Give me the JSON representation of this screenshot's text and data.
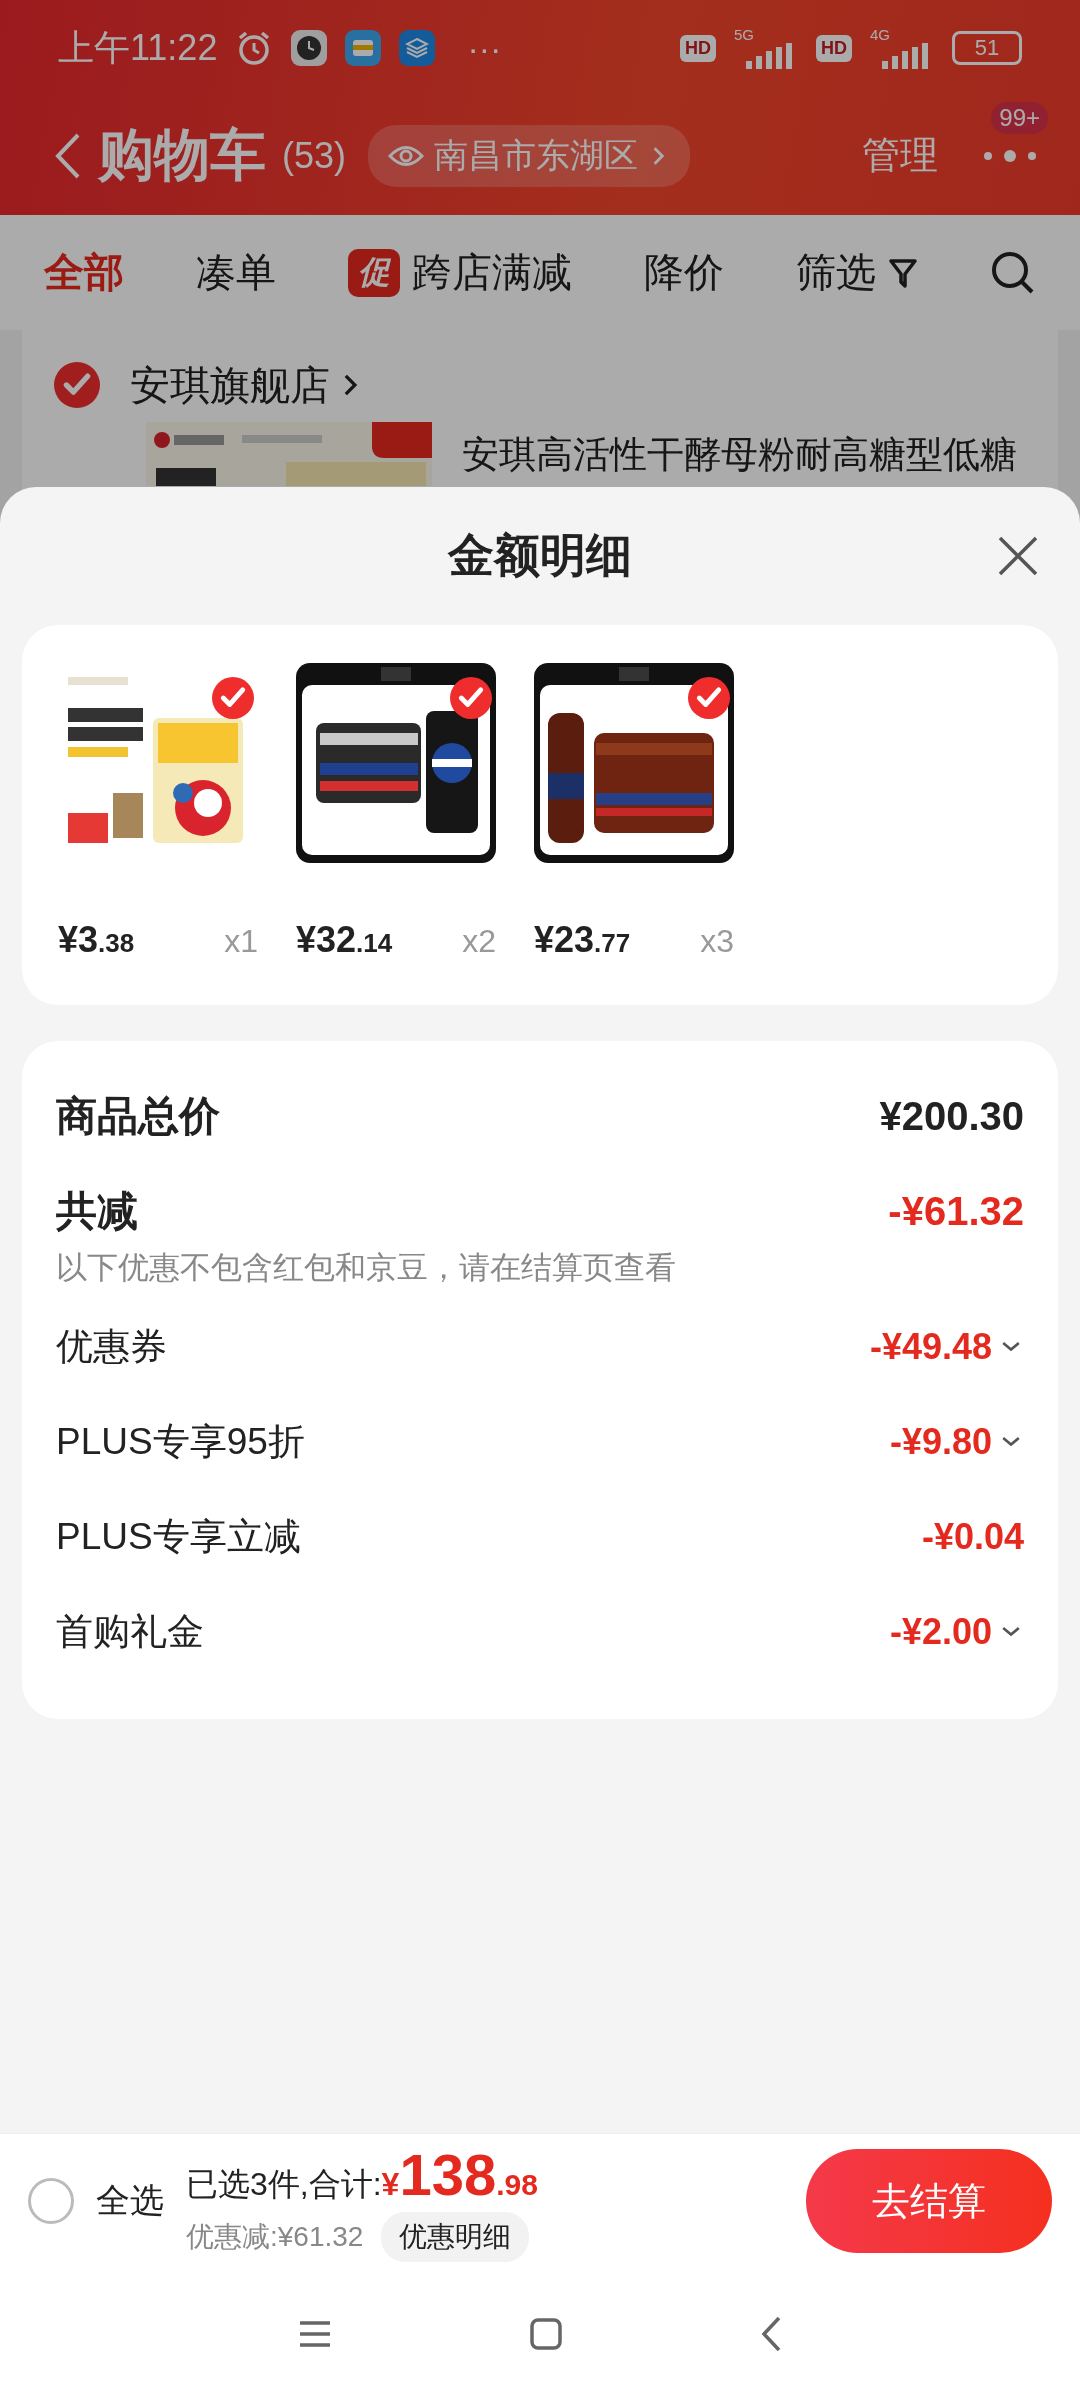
{
  "status_bar": {
    "time": "上午11:22",
    "more": "···",
    "sim1": {
      "hd": "HD",
      "network": "5G"
    },
    "sim2": {
      "hd": "HD",
      "network": "4G"
    },
    "battery": "51"
  },
  "header": {
    "title": "购物车",
    "count": "(53)",
    "location": "南昌市东湖区",
    "manage": "管理",
    "badge": "99+"
  },
  "filter_tabs": [
    {
      "label": "全部",
      "selected": true,
      "kind": "text"
    },
    {
      "label": "凑单",
      "selected": false,
      "kind": "text"
    },
    {
      "label": "跨店满减",
      "selected": false,
      "kind": "promo",
      "tag": "促"
    },
    {
      "label": "降价",
      "selected": false,
      "kind": "text"
    },
    {
      "label": "筛选",
      "selected": false,
      "kind": "filter"
    }
  ],
  "store": {
    "name": "安琪旗舰店",
    "checked": true,
    "product_title": "安琪高活性干酵母粉耐高糖型低糖"
  },
  "sheet": {
    "title": "金额明细",
    "items": [
      {
        "price_main": "¥3",
        "price_decimal": ".38",
        "quantity": "x1",
        "checked": true
      },
      {
        "price_main": "¥32",
        "price_decimal": ".14",
        "quantity": "x2",
        "checked": true
      },
      {
        "price_main": "¥23",
        "price_decimal": ".77",
        "quantity": "x3",
        "checked": true
      }
    ],
    "total": {
      "label": "商品总价",
      "amount": "¥200.30"
    },
    "reduction": {
      "label": "共减",
      "amount": "-¥61.32",
      "note": "以下优惠不包含红包和京豆，请在结算页查看"
    },
    "discounts": [
      {
        "label": "优惠券",
        "amount": "-¥49.48",
        "expandable": true
      },
      {
        "label": "PLUS专享95折",
        "amount": "-¥9.80",
        "expandable": true
      },
      {
        "label": "PLUS专享立减",
        "amount": "-¥0.04",
        "expandable": false
      },
      {
        "label": "首购礼金",
        "amount": "-¥2.00",
        "expandable": true
      }
    ]
  },
  "bottom_bar": {
    "select_all": {
      "label": "全选",
      "checked": false
    },
    "summary": "已选3件,合计:",
    "currency": "¥",
    "total_main": "138",
    "total_decimal": ".98",
    "saving": "优惠减:¥61.32",
    "detail_button": "优惠明细",
    "checkout": "去结算"
  }
}
